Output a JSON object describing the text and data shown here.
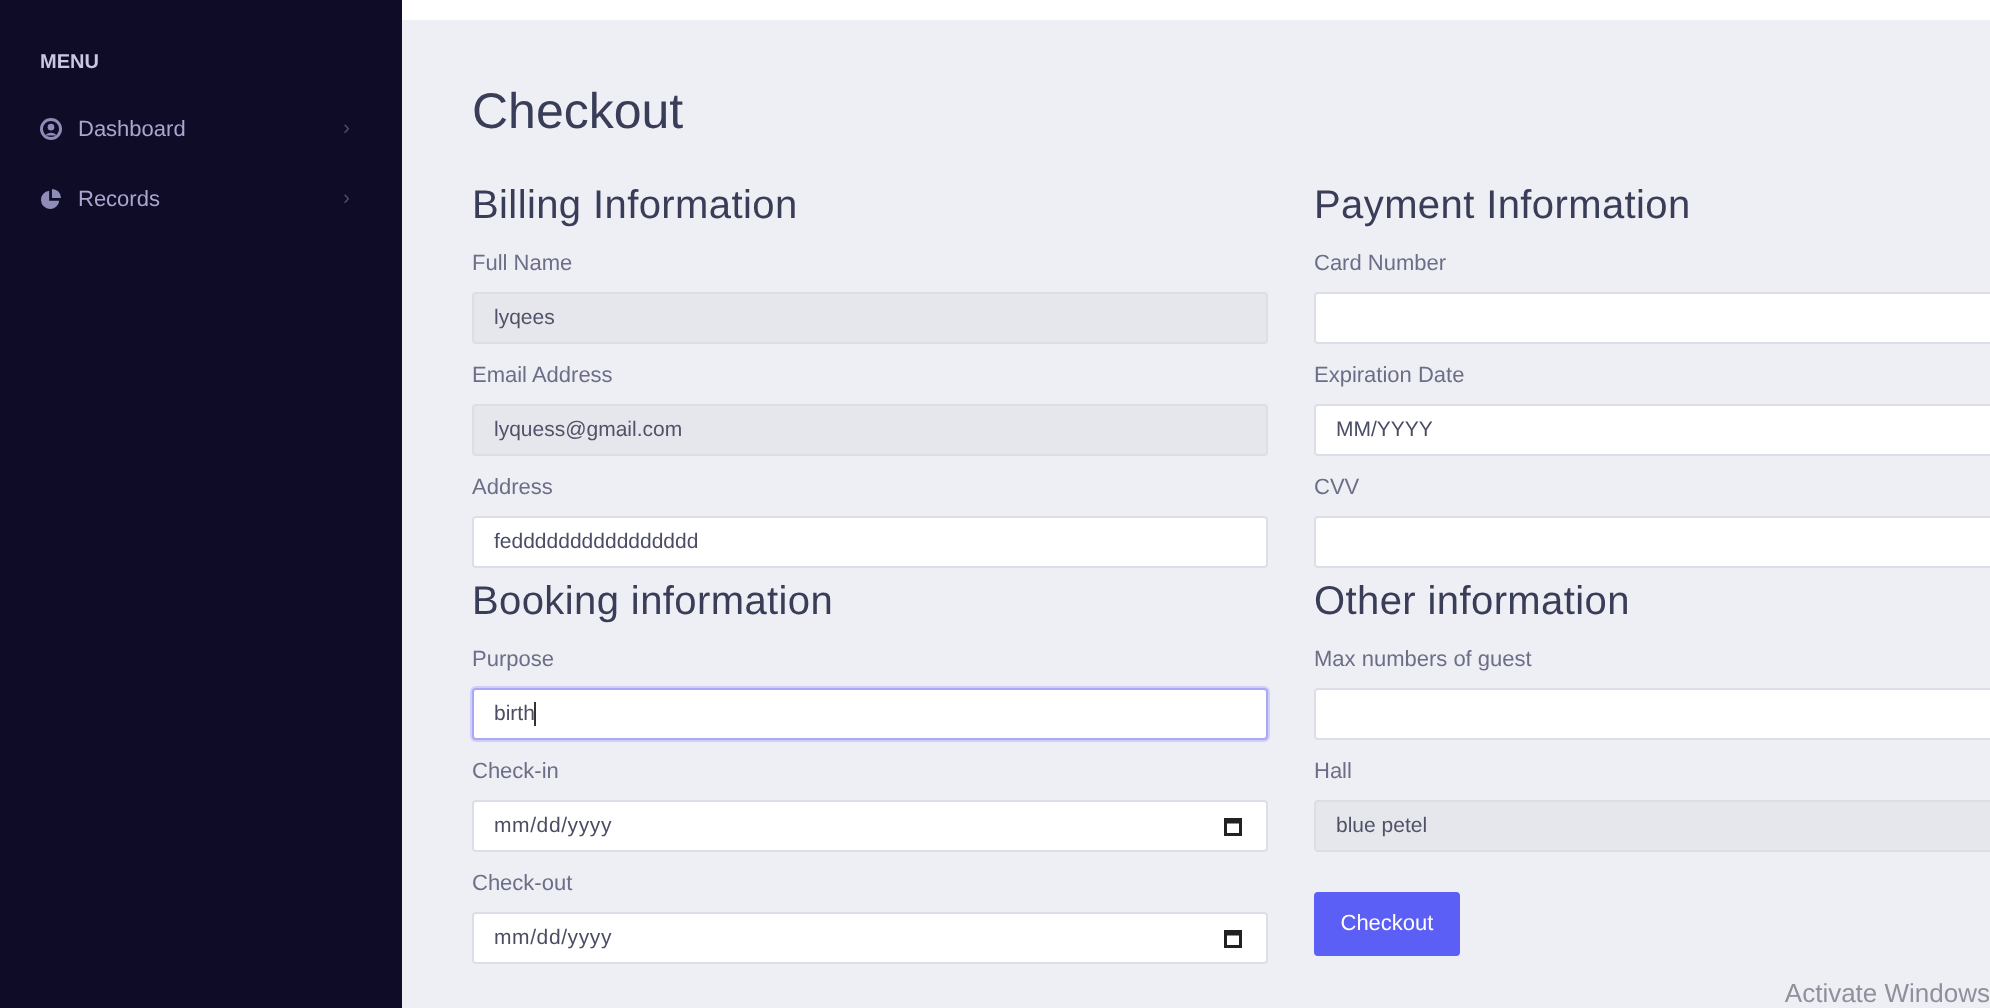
{
  "sidebar": {
    "heading": "MENU",
    "items": [
      {
        "label": "Dashboard",
        "kind": "user",
        "chevron": "›"
      },
      {
        "label": "Records",
        "kind": "chart",
        "chevron": "›"
      }
    ]
  },
  "page": {
    "title": "Checkout"
  },
  "sections": [
    {
      "title": "Billing Information",
      "fields": [
        {
          "label": "Full Name",
          "kind": "text",
          "value": "lyqees",
          "disabled": true,
          "focused": false
        },
        {
          "label": "Email Address",
          "kind": "text",
          "value": "lyquess@gmail.com",
          "disabled": true,
          "focused": false
        },
        {
          "label": "Address",
          "kind": "text",
          "value": "fedddddddddddddddd",
          "disabled": false,
          "focused": false
        }
      ]
    },
    {
      "title": "Payment Information",
      "fields": [
        {
          "label": "Card Number",
          "kind": "text",
          "disabled": false,
          "focused": false
        },
        {
          "label": "Expiration Date",
          "kind": "text",
          "value": "MM/YYYY",
          "disabled": false,
          "focused": false
        },
        {
          "label": "CVV",
          "kind": "text",
          "disabled": false,
          "focused": false
        }
      ]
    },
    {
      "title": "Booking information",
      "fields": [
        {
          "label": "Purpose",
          "kind": "text",
          "value": "birth",
          "disabled": false,
          "focused": true
        },
        {
          "label": "Check-in",
          "kind": "date",
          "placeholder": "mm/dd/yyyy",
          "disabled": false,
          "focused": false
        },
        {
          "label": "Check-out",
          "kind": "date",
          "placeholder": "mm/dd/yyyy",
          "disabled": false,
          "focused": false
        }
      ]
    },
    {
      "title": "Other information",
      "fields": [
        {
          "label": "Max numbers of guest",
          "kind": "text",
          "disabled": false,
          "focused": false
        },
        {
          "label": "Hall",
          "kind": "text",
          "value": "blue petel",
          "disabled": true,
          "focused": false
        }
      ],
      "button": "Checkout"
    }
  ],
  "overlay": {
    "text": "Activate Windows"
  }
}
